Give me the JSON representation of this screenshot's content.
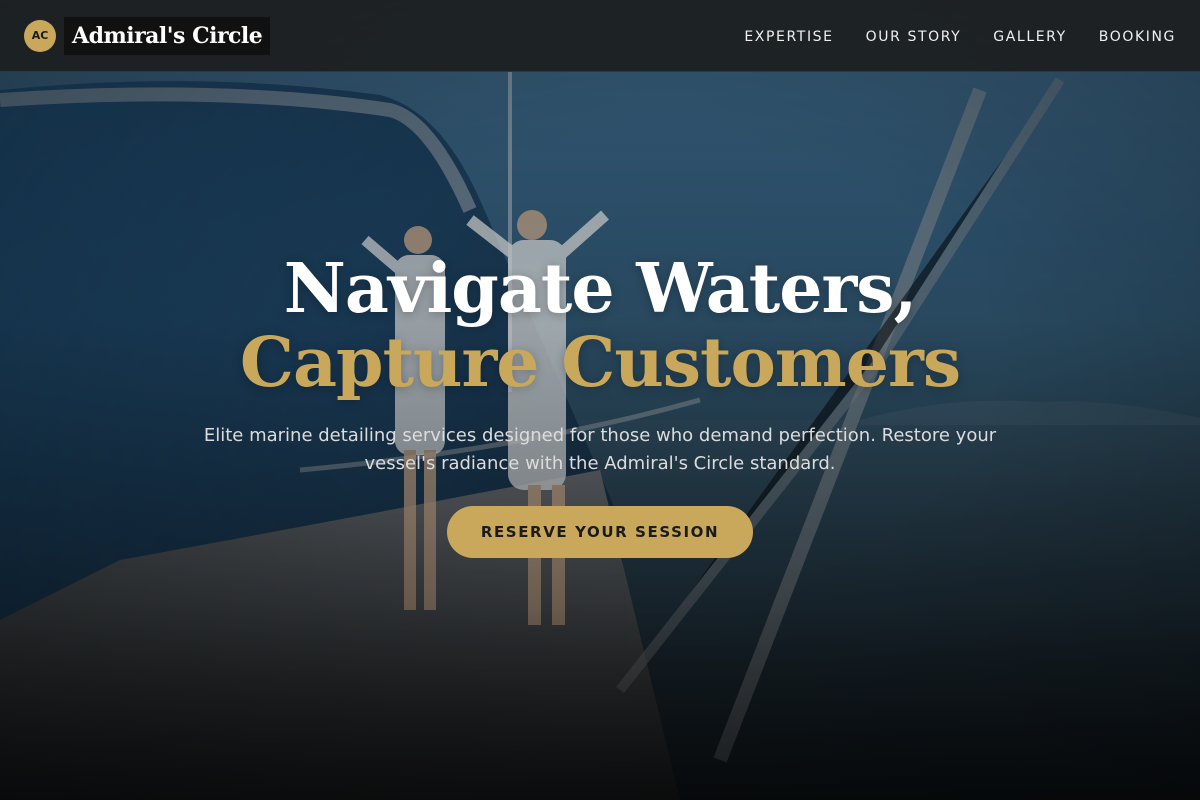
{
  "brand": {
    "initials": "AC",
    "name": "Admiral's Circle"
  },
  "nav": {
    "links": [
      {
        "label": "EXPERTISE"
      },
      {
        "label": "OUR STORY"
      },
      {
        "label": "GALLERY"
      },
      {
        "label": "BOOKING"
      }
    ]
  },
  "hero": {
    "headline_line1": "Navigate Waters,",
    "headline_line2": "Capture Customers",
    "subtitle": "Elite marine detailing services designed for those who demand perfection. Restore your vessel's radiance with the Admiral's Circle standard.",
    "cta_label": "RESERVE YOUR SESSION",
    "background_image": "yacht-deck-photo"
  },
  "colors": {
    "accent_gold": "#c9a85c",
    "nav_background": "#1c1e20",
    "headline_white": "#ffffff"
  }
}
